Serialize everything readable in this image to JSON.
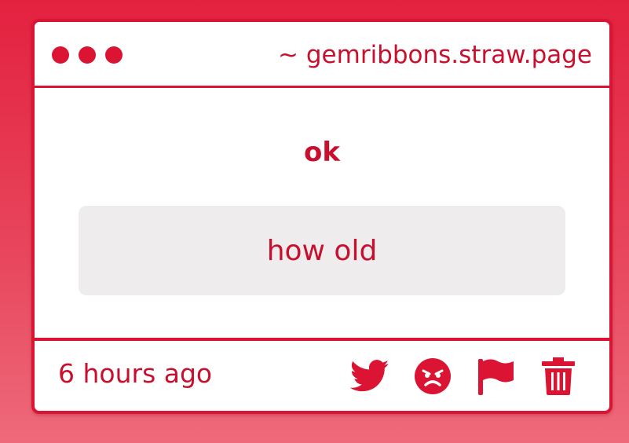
{
  "window": {
    "url": "~ gemribbons.straw.page"
  },
  "post": {
    "question": "ok",
    "answer": "how old",
    "timestamp": "6 hours ago"
  },
  "actions": [
    {
      "icon": "twitter-icon"
    },
    {
      "icon": "angry-face-icon"
    },
    {
      "icon": "flag-icon"
    },
    {
      "icon": "trash-icon"
    }
  ],
  "colors": {
    "accent": "#dc1433",
    "text": "#c8102e",
    "answer_bg": "#eeeced"
  }
}
